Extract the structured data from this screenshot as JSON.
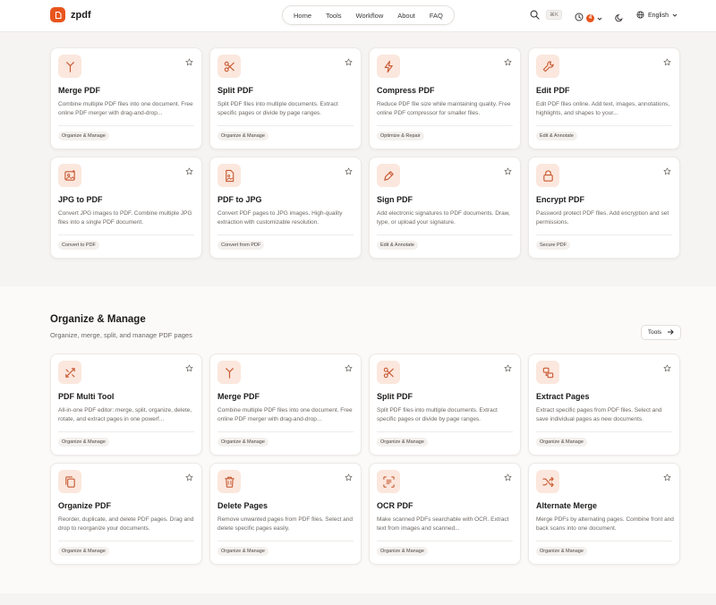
{
  "header": {
    "brand": "zpdf",
    "nav": [
      "Home",
      "Tools",
      "Workflow",
      "About",
      "FAQ"
    ],
    "search_shortcut": "⌘K",
    "notification_count": "4",
    "language": "English"
  },
  "top_cards": [
    {
      "title": "Merge PDF",
      "desc": "Combine multiple PDF files into one document. Free online PDF merger with drag-and-drop...",
      "tag": "Organize & Manage",
      "icon": "merge-icon"
    },
    {
      "title": "Split PDF",
      "desc": "Split PDF files into multiple documents. Extract specific pages or divide by page ranges.",
      "tag": "Organize & Manage",
      "icon": "scissors-icon"
    },
    {
      "title": "Compress PDF",
      "desc": "Reduce PDF file size while maintaining quality. Free online PDF compressor for smaller files.",
      "tag": "Optimize & Repair",
      "icon": "lightning-icon"
    },
    {
      "title": "Edit PDF",
      "desc": "Edit PDF files online. Add text, images, annotations, highlights, and shapes to your...",
      "tag": "Edit & Annotate",
      "icon": "wrench-icon"
    },
    {
      "title": "JPG to PDF",
      "desc": "Convert JPG images to PDF. Combine multiple JPG files into a single PDF document.",
      "tag": "Convert to PDF",
      "icon": "image-plus-icon"
    },
    {
      "title": "PDF to JPG",
      "desc": "Convert PDF pages to JPG images. High-quality extraction with customizable resolution.",
      "tag": "Convert from PDF",
      "icon": "file-image-icon"
    },
    {
      "title": "Sign PDF",
      "desc": "Add electronic signatures to PDF documents. Draw, type, or upload your signature.",
      "tag": "Edit & Annotate",
      "icon": "pen-icon"
    },
    {
      "title": "Encrypt PDF",
      "desc": "Password protect PDF files. Add encryption and set permissions.",
      "tag": "Secure PDF",
      "icon": "lock-icon"
    }
  ],
  "section": {
    "title": "Organize & Manage",
    "subtitle": "Organize, merge, split, and manage PDF pages",
    "tools_button": "Tools"
  },
  "section_cards": [
    {
      "title": "PDF Multi Tool",
      "desc": "All-in-one PDF editor: merge, split, organize, delete, rotate, and extract pages in one powerf...",
      "tag": "Organize & Manage",
      "icon": "multi-tool-icon"
    },
    {
      "title": "Merge PDF",
      "desc": "Combine multiple PDF files into one document. Free online PDF merger with drag-and-drop...",
      "tag": "Organize & Manage",
      "icon": "merge-icon"
    },
    {
      "title": "Split PDF",
      "desc": "Split PDF files into multiple documents. Extract specific pages or divide by page ranges.",
      "tag": "Organize & Manage",
      "icon": "scissors-icon"
    },
    {
      "title": "Extract Pages",
      "desc": "Extract specific pages from PDF files. Select and save individual pages as new documents.",
      "tag": "Organize & Manage",
      "icon": "extract-icon"
    },
    {
      "title": "Organize PDF",
      "desc": "Reorder, duplicate, and delete PDF pages. Drag and drop to reorganize your documents.",
      "tag": "Organize & Manage",
      "icon": "copy-icon"
    },
    {
      "title": "Delete Pages",
      "desc": "Remove unwanted pages from PDF files. Select and delete specific pages easily.",
      "tag": "Organize & Manage",
      "icon": "trash-icon"
    },
    {
      "title": "OCR PDF",
      "desc": "Make scanned PDFs searchable with OCR. Extract text from images and scanned...",
      "tag": "Organize & Manage",
      "icon": "scan-text-icon"
    },
    {
      "title": "Alternate Merge",
      "desc": "Merge PDFs by alternating pages. Combine front and back scans into one document.",
      "tag": "Organize & Manage",
      "icon": "shuffle-icon"
    }
  ],
  "colors": {
    "accent": "#e8541c",
    "icon_bg": "#fbe7dd"
  }
}
